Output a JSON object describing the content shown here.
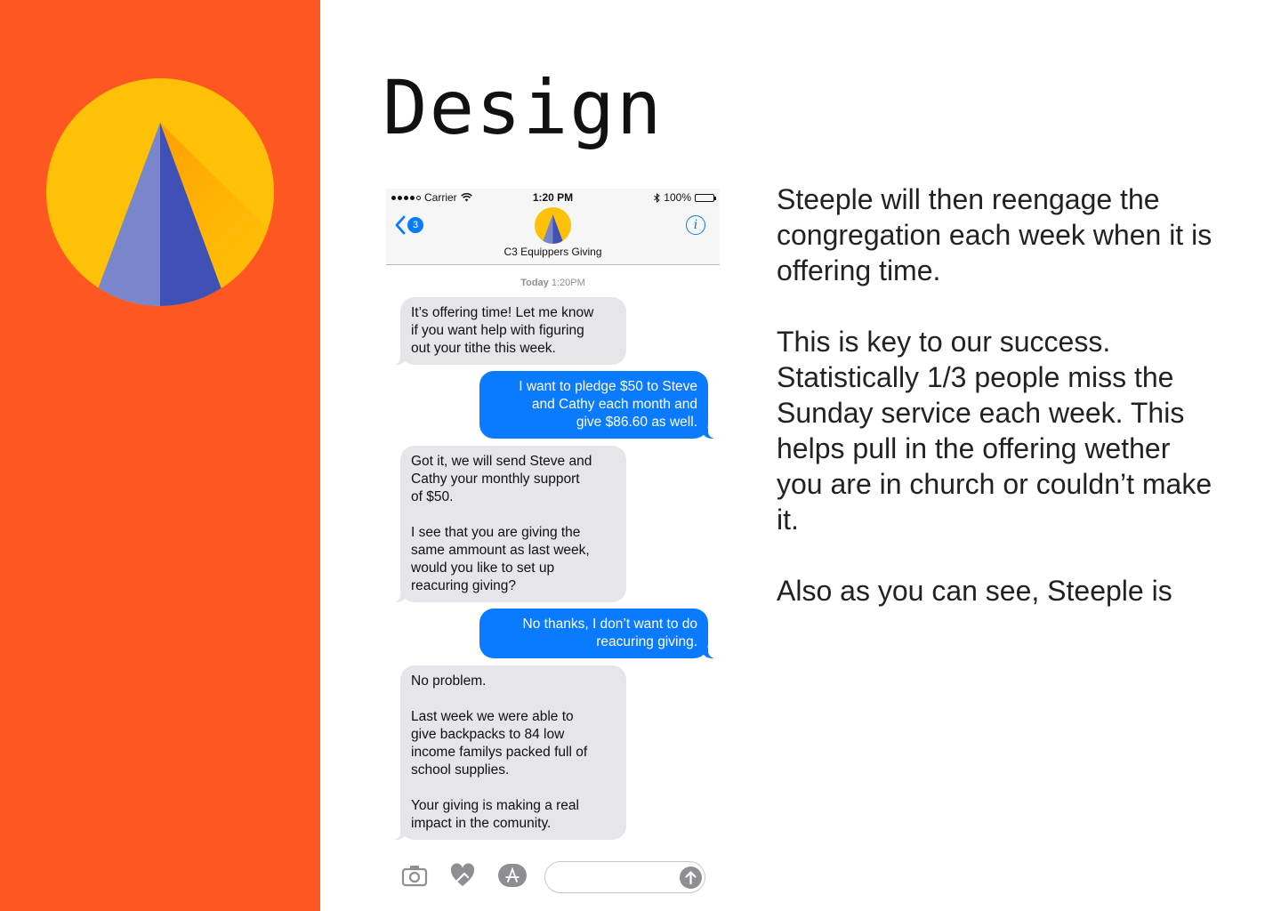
{
  "colors": {
    "sidebar": "#ff5722",
    "logo_circle": "#ffc107",
    "logo_shadow": "#ff9800",
    "logo_left": "#7986cb",
    "logo_right": "#3f51b5",
    "imessage_blue": "#0a7aff",
    "incoming_bubble": "#e5e5ea"
  },
  "icons": {
    "logo": "steeple-logo-icon",
    "wifi": "wifi-icon",
    "bluetooth": "bluetooth-icon",
    "battery": "battery-icon",
    "back": "chevron-left-icon",
    "info": "info-icon",
    "camera": "camera-icon",
    "digital_touch": "heart-touch-icon",
    "app_store": "app-store-icon",
    "send": "arrow-up-icon"
  },
  "page": {
    "title": "Design"
  },
  "phone": {
    "status_bar": {
      "carrier": "Carrier",
      "time": "1:20 PM",
      "battery": "100%"
    },
    "nav": {
      "back_count": "3",
      "contact_name": "C3 Equippers Giving",
      "info_glyph": "i"
    },
    "timestamp": {
      "day": "Today",
      "time": "1:20PM"
    },
    "messages": [
      {
        "direction": "incoming",
        "text": "It’s offering time! Let me know\nif you want help with figuring\nout your tithe this week."
      },
      {
        "direction": "outgoing",
        "text": "I want to pledge $50 to Steve\nand Cathy each month and\ngive $86.60 as well."
      },
      {
        "direction": "incoming",
        "text": "Got it, we will send Steve and\nCathy your monthly support\nof $50.\n\nI see that you are giving the\nsame ammount as last week,\nwould you like to set up\nreacuring giving?"
      },
      {
        "direction": "outgoing",
        "text": "No thanks, I don’t want to do\nreacuring giving."
      },
      {
        "direction": "incoming",
        "text": "No problem.\n\nLast week we were able to\ngive backpacks to 84 low\nincome familys packed full of\nschool supplies.\n\nYour giving is making a real\nimpact in the comunity."
      }
    ],
    "compose": {
      "value": ""
    }
  },
  "body": {
    "paragraphs": [
      "Steeple will then reengage the congregation each week when it is offering time.",
      "This is key to our success. Statistically 1/3 people miss the Sunday service each week. This helps pull in the offering wether you are in church or couldn’t make it.",
      "Also as you can see, Steeple is"
    ]
  }
}
